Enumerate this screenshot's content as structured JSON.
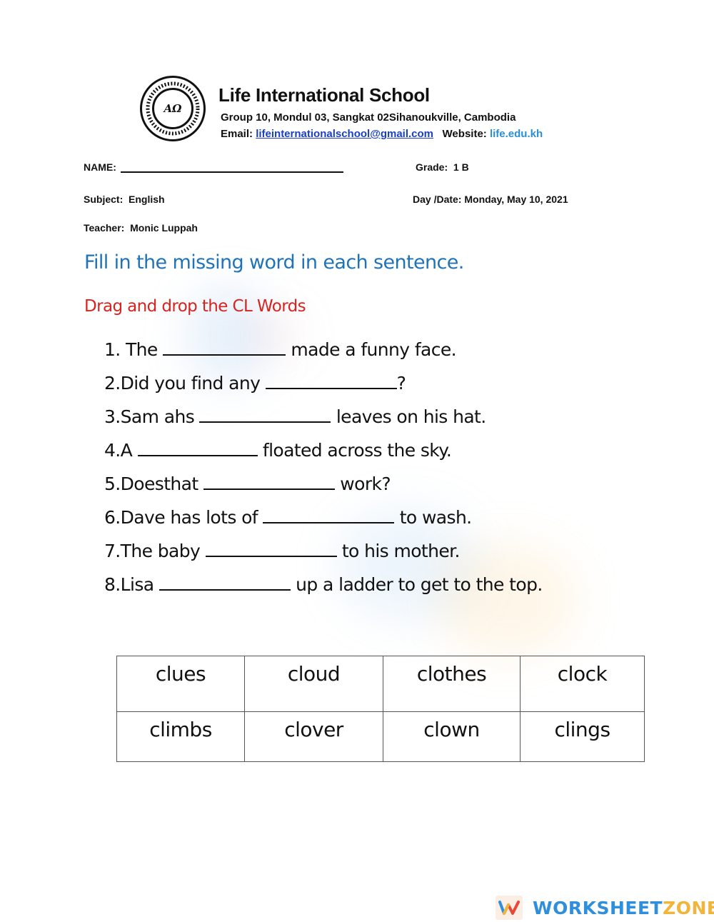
{
  "header": {
    "school_name": "Life International School",
    "logo_center_text": "AΩ",
    "address": "Group 10, Mondul 03, Sangkat 02Sihanoukville, Cambodia",
    "email_label": "Email:",
    "email": "lifeinternationalschool@gmail.com",
    "website_label": "Website:",
    "website": "life.edu.kh"
  },
  "info": {
    "name_label": "NAME:",
    "grade_label": "Grade:",
    "grade_value": "1 B",
    "subject_label": "Subject:",
    "subject_value": "English",
    "date_label": "Day /Date:",
    "date_value": "Monday, May 10, 2021",
    "teacher_label": "Teacher:",
    "teacher_value": "Monic Luppah"
  },
  "instruction": "Fill in the missing word in each sentence.",
  "drag_label": "Drag and drop the CL Words",
  "sentences": [
    {
      "number": "1.",
      "before": "The ",
      "after": " made a funny face."
    },
    {
      "number": "2.",
      "before": "Did you find any ",
      "after": "?"
    },
    {
      "number": "3.",
      "before": "Sam ahs ",
      "after": " leaves on his hat."
    },
    {
      "number": "4.",
      "before": "A ",
      "after": " floated across the sky."
    },
    {
      "number": "5.",
      "before": "Doesthat ",
      "after": " work?"
    },
    {
      "number": "6.",
      "before": "Dave has lots of ",
      "after": " to wash."
    },
    {
      "number": "7.",
      "before": "The baby ",
      "after": " to his mother."
    },
    {
      "number": "8.",
      "before": "Lisa ",
      "after": " up a ladder to get to the top."
    }
  ],
  "word_bank": [
    [
      "clues",
      "cloud",
      "clothes",
      "clock"
    ],
    [
      "climbs",
      "clover",
      "clown",
      "clings"
    ]
  ],
  "brand": {
    "part1": "WORKSHEET",
    "part2": "ZONE",
    "logo_letter": "W"
  },
  "colors": {
    "instruction": "#1f73b8",
    "drag_label": "#d8231e",
    "email_link": "#1a3fc4",
    "website_link": "#2a8fd6",
    "brand_blue": "#2f8fdc",
    "brand_orange": "#f2b53c"
  }
}
